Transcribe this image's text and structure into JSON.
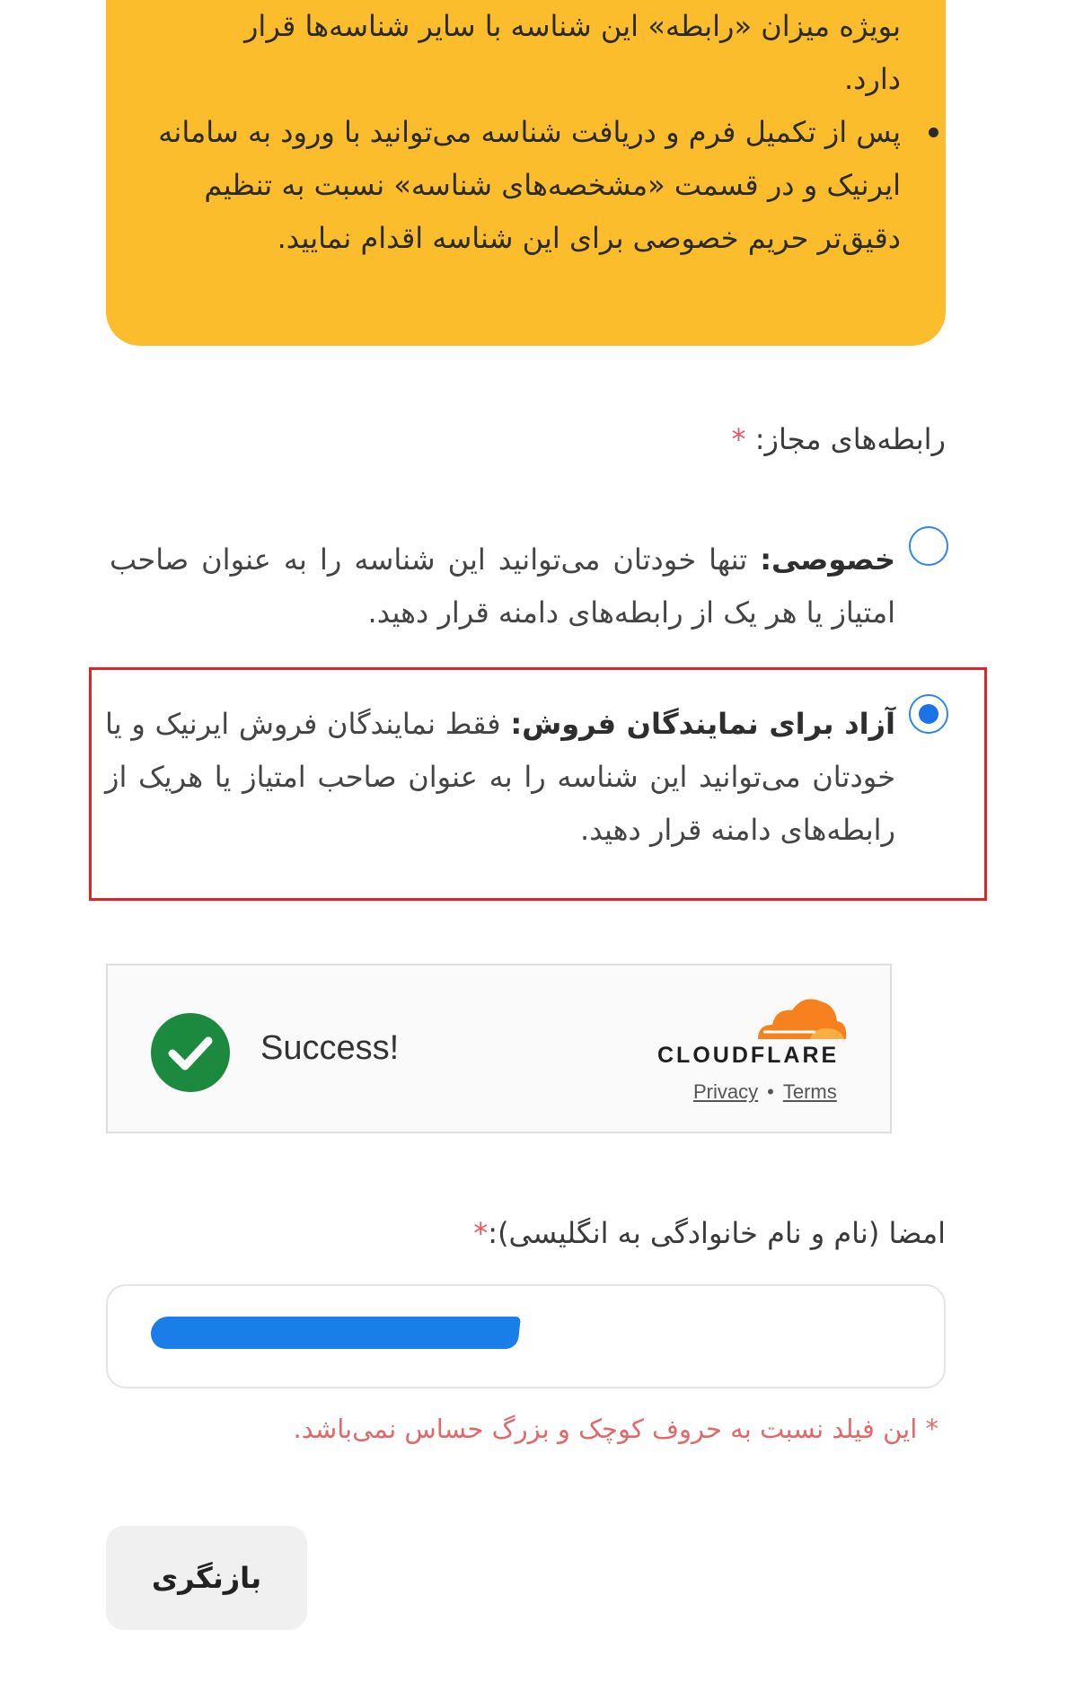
{
  "notice": {
    "line_partial": "بویژه میزان «رابطه» این شناسه با سایر شناسه‌ها قرار",
    "line_end": "دارد.",
    "bullet": "پس از تکمیل فرم و دریافت شناسه می‌توانید با ورود به سامانه ایرنیک و در قسمت «مشخصه‌های شناسه» نسبت به تنظیم دقیق‌تر حریم خصوصی برای این شناسه اقدام نمایید."
  },
  "relations": {
    "label": "رابطه‌های مجاز:",
    "required_mark": "*",
    "options": [
      {
        "title": "خصوصی:",
        "desc": "تنها خودتان می‌توانید این شناسه را به عنوان صاحب امتیاز یا هر یک از رابطه‌های دامنه قرار دهید.",
        "selected": false
      },
      {
        "title": "آزاد برای نمایندگان فروش:",
        "desc": "فقط نمایندگان فروش ایرنیک و یا خودتان می‌توانید این شناسه را به عنوان صاحب امتیاز یا هریک از رابطه‌های دامنه قرار دهید.",
        "selected": true
      }
    ]
  },
  "captcha": {
    "status": "Success!",
    "brand": "CLOUDFLARE",
    "privacy": "Privacy",
    "separator": "•",
    "terms": "Terms",
    "check_color": "#1b8a3f",
    "cloud_color": "#f6821f"
  },
  "signature": {
    "label": "امضا (نام و نام خانوادگی به انگلیسی):",
    "required_mark": "*",
    "hint": "* این فیلد نسبت به حروف کوچک و بزرگ حساس نمی‌باشد."
  },
  "back_button": "بازنگری",
  "colors": {
    "notice_bg": "#fbbd2b",
    "highlight_border": "#e0222b",
    "radio_accent": "#1a73e8"
  }
}
